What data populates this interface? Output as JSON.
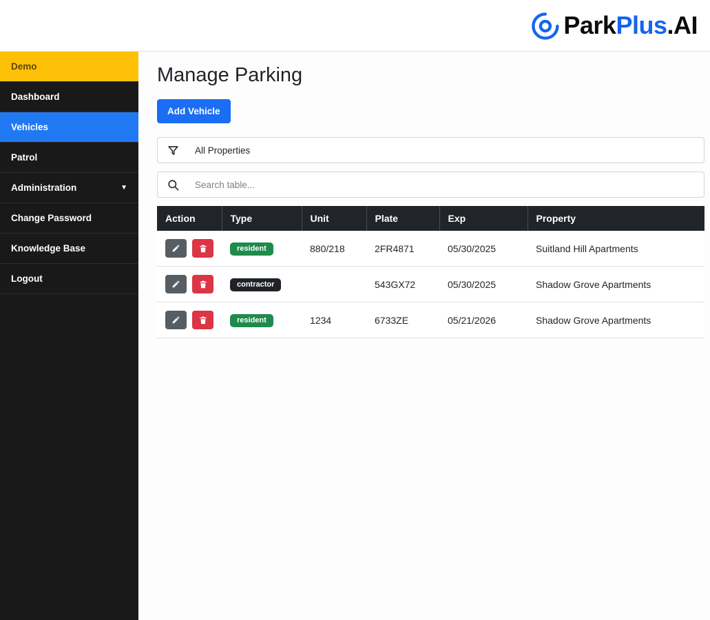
{
  "header": {
    "logo_park": "Park",
    "logo_plus": "Plus",
    "logo_ai": ".AI"
  },
  "sidebar": {
    "items": [
      {
        "label": "Demo"
      },
      {
        "label": "Dashboard"
      },
      {
        "label": "Vehicles"
      },
      {
        "label": "Patrol"
      },
      {
        "label": "Administration",
        "dropdown_arrow": "▼"
      },
      {
        "label": "Change Password"
      },
      {
        "label": "Knowledge Base"
      },
      {
        "label": "Logout"
      }
    ]
  },
  "main": {
    "title": "Manage Parking",
    "add_vehicle_label": "Add Vehicle",
    "filter": {
      "value": "All Properties"
    },
    "search": {
      "placeholder": "Search table..."
    },
    "table": {
      "headers": [
        "Action",
        "Type",
        "Unit",
        "Plate",
        "Exp",
        "Property"
      ],
      "rows": [
        {
          "type": "resident",
          "type_color": "#1e8a4c",
          "unit": "880/218",
          "plate": "2FR4871",
          "exp": "05/30/2025",
          "property": "Suitland Hill Apartments"
        },
        {
          "type": "contractor",
          "type_color": "#1f2327",
          "unit": "",
          "plate": "543GX72",
          "exp": "05/30/2025",
          "property": "Shadow Grove Apartments"
        },
        {
          "type": "resident",
          "type_color": "#1e8a4c",
          "unit": "1234",
          "plate": "6733ZE",
          "exp": "05/21/2026",
          "property": "Shadow Grove Apartments"
        }
      ]
    }
  },
  "colors": {
    "brand_blue": "#1465f1",
    "primary_button": "#1b6ef3",
    "sidebar_demo_highlight": "#ffc107",
    "sidebar_active": "#2079f2",
    "table_header": "#212529",
    "badge_resident": "#1e8a4c",
    "badge_contractor": "#1f2327",
    "delete_red": "#dc3545",
    "edit_gray": "#565e64"
  }
}
